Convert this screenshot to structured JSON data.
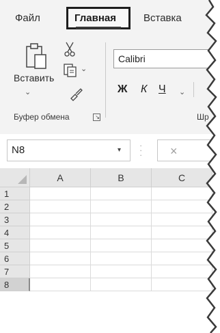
{
  "tabs": {
    "file": "Файл",
    "home": "Главная",
    "insert": "Вставка"
  },
  "ribbon": {
    "paste_label": "Вставить",
    "clipboard_group": "Буфер обмена",
    "font_name": "Calibri",
    "bold": "Ж",
    "italic": "К",
    "underline": "Ч",
    "font_group": "Шр"
  },
  "formula_bar": {
    "name_box": "N8",
    "cancel": "×"
  },
  "grid": {
    "columns": [
      "A",
      "B",
      "C"
    ],
    "rows": [
      "1",
      "2",
      "3",
      "4",
      "5",
      "6",
      "7",
      "8"
    ],
    "selected_row": "8"
  },
  "colors": {
    "ribbon_bg": "#f3f3f3",
    "header_bg": "#e6e6e6",
    "highlight_border": "#1d1d1d"
  }
}
